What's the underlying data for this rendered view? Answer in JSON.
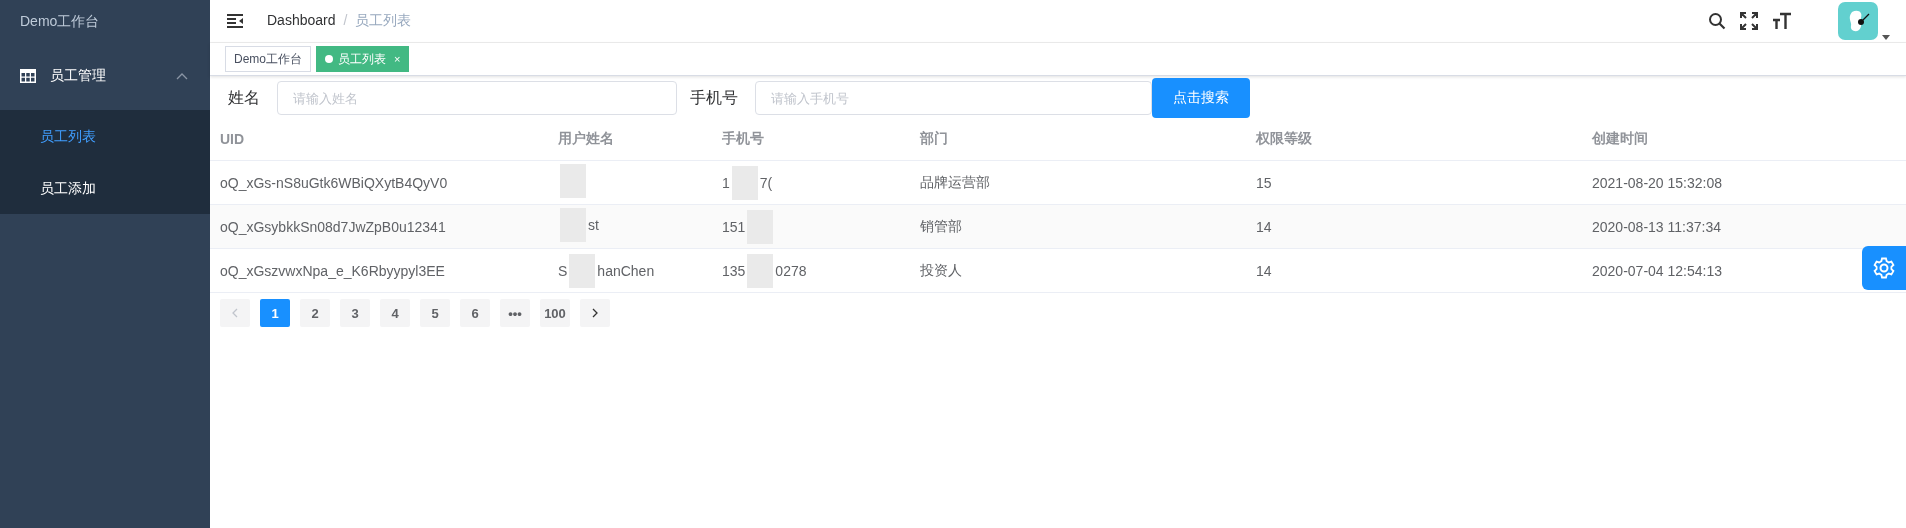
{
  "sidebar": {
    "title": "Demo工作台",
    "groups": [
      {
        "label": "员工管理",
        "expanded": true,
        "children": [
          {
            "label": "员工列表",
            "selected": true
          },
          {
            "label": "员工添加",
            "selected": false
          }
        ]
      }
    ]
  },
  "header": {
    "breadcrumb": [
      "Dashboard",
      "员工列表"
    ],
    "separator": "/"
  },
  "tags": [
    {
      "label": "Demo工作台",
      "selected": false,
      "closable": false
    },
    {
      "label": "员工列表",
      "selected": true,
      "closable": true,
      "close": "×"
    }
  ],
  "search": {
    "fields": [
      {
        "label": "姓名",
        "placeholder": "请输入姓名"
      },
      {
        "label": "手机号",
        "placeholder": "请输入手机号"
      }
    ],
    "button": "点击搜索"
  },
  "table": {
    "columns": [
      "UID",
      "用户姓名",
      "手机号",
      "部门",
      "权限等级",
      "创建时间"
    ],
    "rows": [
      {
        "uid": "oQ_xGs-nS8uGtk6WBiQXytB4QyV0",
        "name": {},
        "phone": {
          "before": "1",
          "after": "7("
        },
        "department": "品牌运营部",
        "level": "15",
        "created": "2021-08-20 15:32:08"
      },
      {
        "uid": "oQ_xGsybkkSn08d7JwZpB0u12341",
        "name": {
          "after": "st"
        },
        "phone": {
          "before": "151"
        },
        "department": "销管部",
        "level": "14",
        "created": "2020-08-13 11:37:34"
      },
      {
        "uid": "oQ_xGszvwxNpa_e_K6Rbyypyl3EE",
        "name": {
          "before": "S",
          "after": "hanChen"
        },
        "phone": {
          "before": "135",
          "after": "0278"
        },
        "department": "投资人",
        "level": "14",
        "created": "2020-07-04 12:54:13"
      }
    ]
  },
  "pagination": {
    "pages": [
      {
        "label": "1",
        "selected": true
      },
      {
        "label": "2",
        "selected": false
      },
      {
        "label": "3",
        "selected": false
      },
      {
        "label": "4",
        "selected": false
      },
      {
        "label": "5",
        "selected": false
      },
      {
        "label": "6",
        "selected": false
      },
      {
        "label": "•••",
        "selected": false
      },
      {
        "label": "100",
        "selected": false
      }
    ]
  }
}
